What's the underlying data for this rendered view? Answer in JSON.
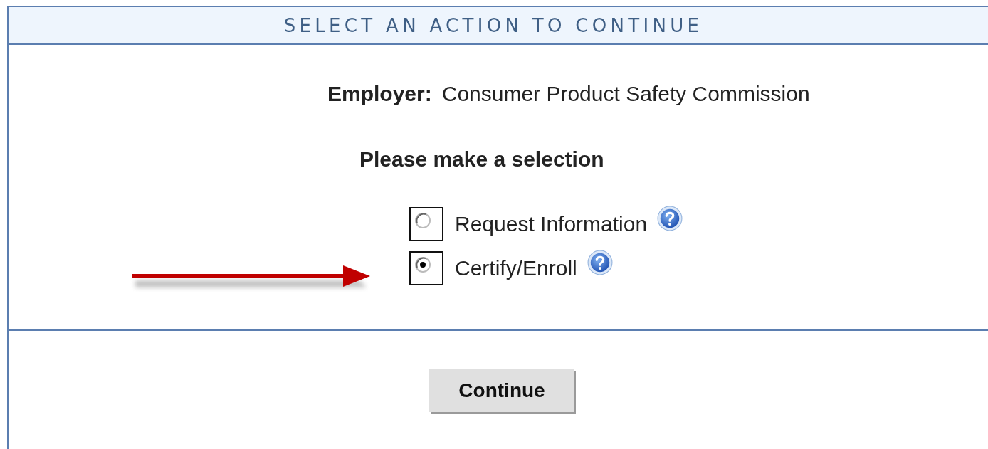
{
  "header": {
    "title": "SELECT AN ACTION TO CONTINUE"
  },
  "employer": {
    "label": "Employer:",
    "value": "Consumer Product Safety Commission"
  },
  "prompt": "Please make a selection",
  "options": [
    {
      "label": "Request Information",
      "selected": false,
      "help": true
    },
    {
      "label": "Certify/Enroll",
      "selected": true,
      "help": true
    }
  ],
  "annotation": {
    "kind": "arrow",
    "color": "#c00000"
  },
  "buttons": [
    {
      "label": "Continue"
    }
  ]
}
